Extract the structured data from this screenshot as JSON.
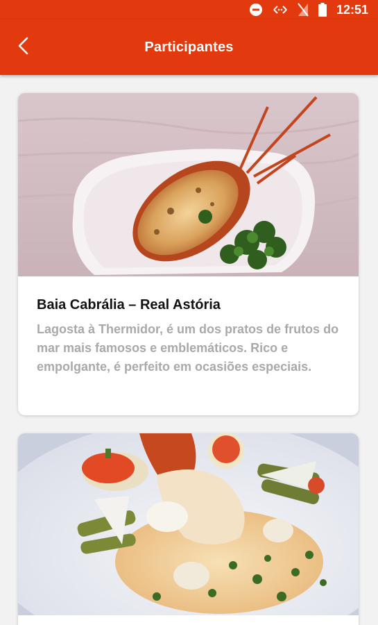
{
  "status_bar": {
    "time": "12:51",
    "icons": [
      "do-not-disturb-icon",
      "data-arrows-icon",
      "no-signal-icon",
      "battery-icon"
    ]
  },
  "app_bar": {
    "title": "Participantes",
    "back_icon": "chevron-left-icon"
  },
  "colors": {
    "primary": "#e23a0e",
    "background": "#f2f2f2",
    "title_text": "#111111",
    "description_text": "#a9a9a9"
  },
  "cards": [
    {
      "title": "Baia Cabrália – Real Astória",
      "description": "Lagosta à Thermidor, é um dos pratos de frutos do mar mais famosos e emblemáticos. Rico e empolgante, é perfeito em ocasiões especiais."
    },
    {
      "title": "",
      "description": ""
    }
  ]
}
